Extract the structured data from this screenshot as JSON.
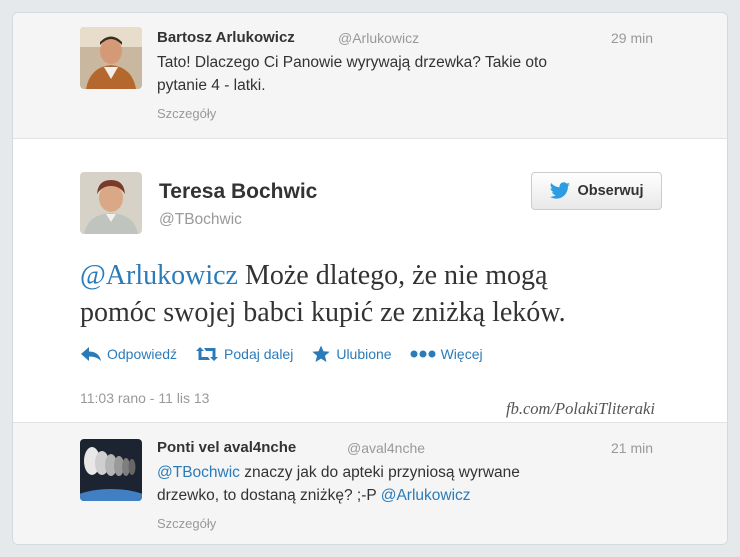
{
  "top_tweet": {
    "name": "Bartosz Arlukowicz",
    "handle": "@Arlukowicz",
    "time": "29 min",
    "text_line1": "Tato! Dlaczego Ci Panowie wyrywają drzewka? Takie oto",
    "text_line2": "pytanie 4 - latki.",
    "details": "Szczegóły"
  },
  "main_tweet": {
    "name": "Teresa Bochwic",
    "handle": "@TBochwic",
    "follow_label": "Obserwuj",
    "text_mention": "@Arlukowicz",
    "text_line1_rest": " Może dlatego, że nie mogą",
    "text_line2": "pomóc swojej babci kupić ze zniżką leków.",
    "actions": {
      "reply": "Odpowiedź",
      "retweet": "Podaj dalej",
      "favorite": "Ulubione",
      "more": "Więcej"
    },
    "date": "11:03 rano - 11 lis 13"
  },
  "watermark": "fb.com/PolakiTliteraki",
  "bottom_tweet": {
    "name": "Ponti vel aval4nche",
    "handle": "@aval4nche",
    "time": "21 min",
    "mention1": "@TBochwic",
    "text_line1_rest": " znaczy jak do apteki przyniosą wyrwane",
    "text_line2_start": "drzewko, to dostaną zniżkę? ;-P ",
    "mention2": "@Arlukowicz",
    "details": "Szczegóły"
  },
  "colors": {
    "link": "#2b7bb9",
    "background": "#e6e9ec",
    "muted": "#999999"
  }
}
